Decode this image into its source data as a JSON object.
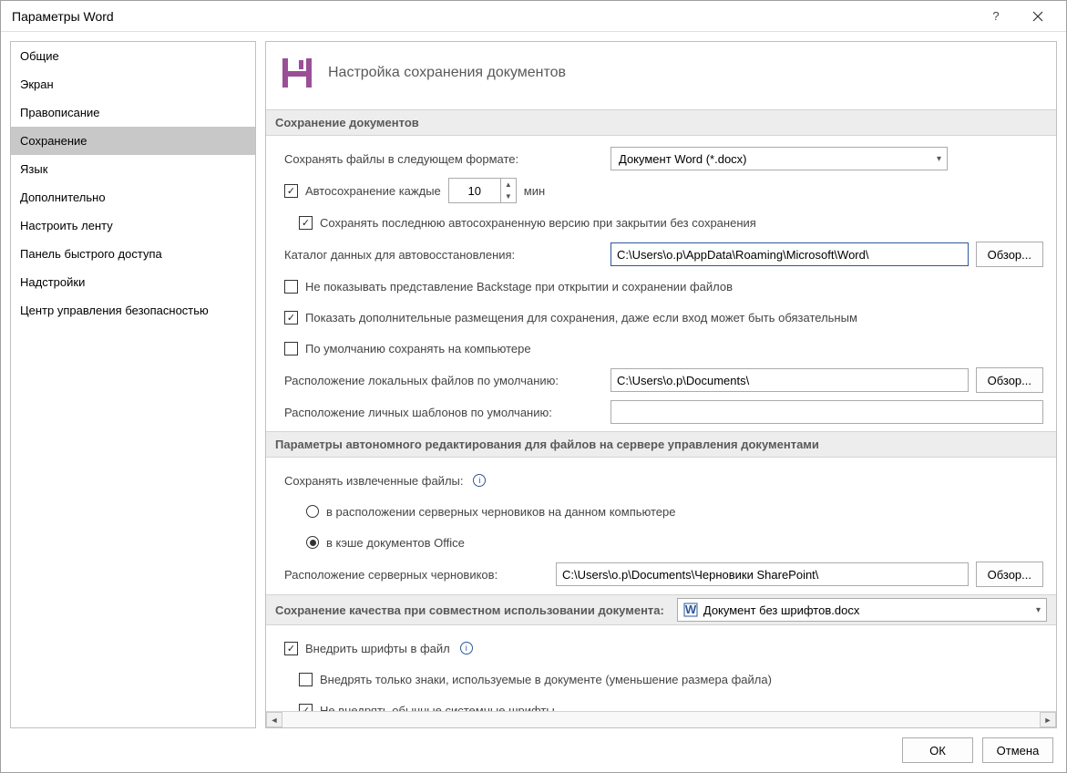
{
  "title": "Параметры Word",
  "sidebar": {
    "items": [
      "Общие",
      "Экран",
      "Правописание",
      "Сохранение",
      "Язык",
      "Дополнительно",
      "Настроить ленту",
      "Панель быстрого доступа",
      "Надстройки",
      "Центр управления безопасностью"
    ],
    "selected_index": 3
  },
  "header": {
    "title": "Настройка сохранения документов"
  },
  "section1": {
    "title": "Сохранение документов",
    "format_label": "Сохранять файлы в следующем формате:",
    "format_value": "Документ Word (*.docx)",
    "autosave_label": "Автосохранение каждые",
    "autosave_value": "10",
    "autosave_unit": "мин",
    "autosave_checked": true,
    "keep_last_label": "Сохранять последнюю автосохраненную версию при закрытии без сохранения",
    "keep_last_checked": true,
    "autorecover_label": "Каталог данных для автовосстановления:",
    "autorecover_path": "C:\\Users\\o.p\\AppData\\Roaming\\Microsoft\\Word\\",
    "browse": "Обзор...",
    "no_backstage_label": "Не показывать представление Backstage при открытии и сохранении файлов",
    "no_backstage_checked": false,
    "show_additional_label": "Показать дополнительные размещения для сохранения, даже если вход может быть обязательным",
    "show_additional_checked": true,
    "save_to_computer_label": "По умолчанию сохранять на компьютере",
    "save_to_computer_checked": false,
    "default_local_label": "Расположение локальных файлов по умолчанию:",
    "default_local_path": "C:\\Users\\o.p\\Documents\\",
    "personal_templates_label": "Расположение личных шаблонов по умолчанию:",
    "personal_templates_path": ""
  },
  "section2": {
    "title": "Параметры автономного редактирования для файлов на сервере управления документами",
    "save_checked_out_label": "Сохранять извлеченные файлы:",
    "opt_server_drafts_label": "в расположении серверных черновиков на данном компьютере",
    "opt_cache_label": "в кэше документов Office",
    "selected_option": "cache",
    "server_drafts_label": "Расположение серверных черновиков:",
    "server_drafts_path": "C:\\Users\\o.p\\Documents\\Черновики SharePoint\\",
    "browse": "Обзор..."
  },
  "section3": {
    "title": "Сохранение качества при совместном использовании документа:",
    "doc_name": "Документ без шрифтов.docx",
    "embed_fonts_label": "Внедрить шрифты в файл",
    "embed_fonts_checked": true,
    "embed_subset_label": "Внедрять только знаки, используемые в документе (уменьшение размера файла)",
    "embed_subset_checked": false,
    "no_system_fonts_label": "Не внедрять обычные системные шрифты",
    "no_system_fonts_checked": true
  },
  "footer": {
    "ok": "ОК",
    "cancel": "Отмена"
  }
}
